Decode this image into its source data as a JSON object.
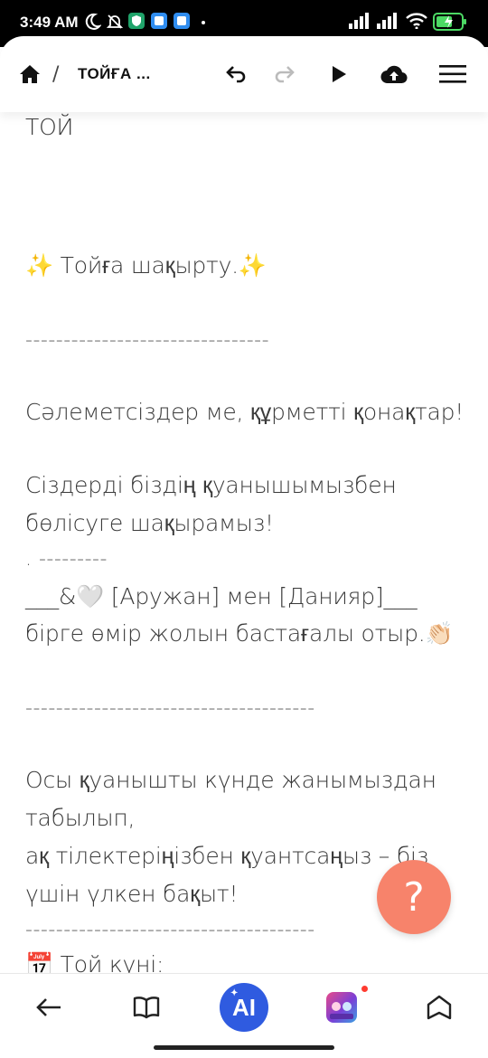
{
  "status_bar": {
    "time": "3:49 AM",
    "icons": [
      "moon-icon",
      "mute-bell-icon",
      "vpn-shield-icon",
      "app-notification-icon",
      "app-notification-icon",
      "signal-icon",
      "signal-icon",
      "wifi-icon",
      "battery-charging-icon"
    ],
    "battery": "53"
  },
  "toolbar": {
    "home_icon": "home-icon",
    "separator": "/",
    "title": "ТОЙҒА ...",
    "undo_icon": "undo-icon",
    "redo_icon": "redo-icon",
    "play_icon": "play-icon",
    "upload_icon": "cloud-upload-icon",
    "menu_icon": "hamburger-menu-icon"
  },
  "document": {
    "lines": [
      "ТОЙ",
      "✨ Тойға шақырту.✨",
      "--------------------------------",
      "Сәлеметсіздер ме, құрметті қонақтар!",
      "Сіздерді біздің қуанышымызбен",
      "бөлісуге шақырамыз!",
      "   . ---------",
      "___&🤍 [Аружан] мен [Данияр]___",
      "бірге өмір жолын бастағалы отыр.👏🏻",
      "--------------------------------------",
      "Осы қуанышты күнде жанымыздан",
      "табылып,",
      "ақ тілектеріңізбен қуантсаңыз – біз",
      "үшін үлкен бақыт!",
      "--------------------------------------",
      "📅 Той күні:"
    ]
  },
  "help_fab": {
    "label": "?"
  },
  "bottom_nav": {
    "back_icon": "back-arrow-icon",
    "book_icon": "book-icon",
    "ai_label": "AI",
    "game_icon": "game-thumbnail-icon",
    "share_icon": "bookmark-icon"
  },
  "colors": {
    "accent_blue": "#2f5be0",
    "fab_coral": "#f7836b",
    "text": "#3a3a3a"
  }
}
